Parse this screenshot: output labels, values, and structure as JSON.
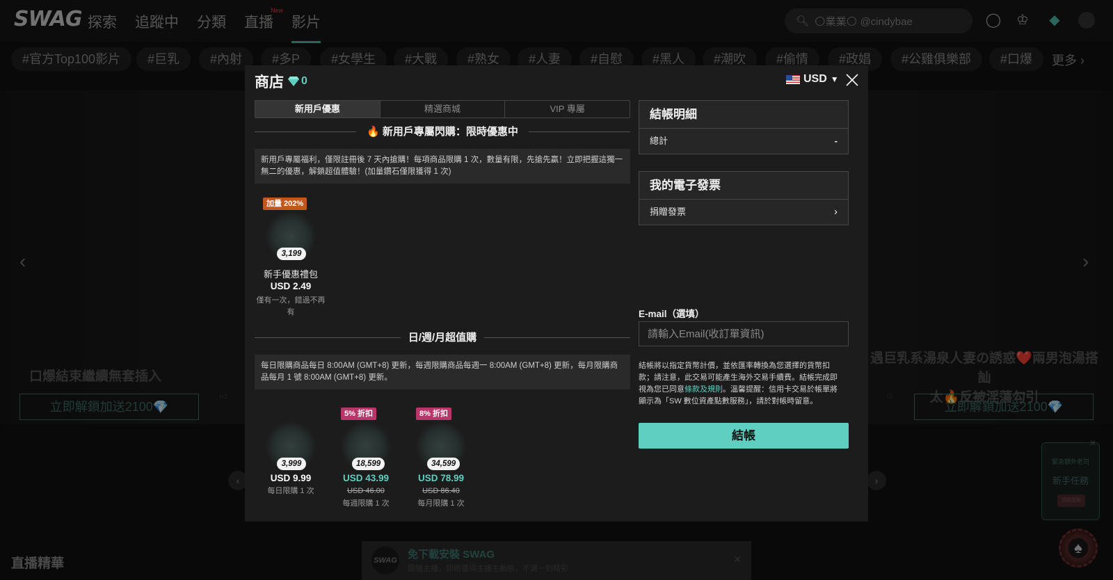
{
  "site": {
    "logo": "SWAG",
    "nav": [
      "探索",
      "追蹤中",
      "分類",
      "直播",
      "影片"
    ],
    "nav_active": 4,
    "new_badge": "New",
    "search_placeholder": "🌕業業🌕 @cindybae",
    "tags": [
      "#官方Top100影片",
      "#巨乳",
      "#內射",
      "#多P",
      "#女學生",
      "#大戰",
      "#熟女",
      "#人妻",
      "#自慰",
      "#黑人",
      "#潮吹",
      "#偷情",
      "#政娼",
      "#公雞俱樂部",
      "#口爆"
    ],
    "more_label": "更多",
    "hero": {
      "left_title": "口爆結束繼續無套插入",
      "right_title_line1": "遇巨乳系湯泉人妻の誘惑❤️兩男泡湯搭訕",
      "right_title_line2": "太🔥反被淫蕩勾引",
      "left_button": "立即解鎖加送2100💎",
      "right_button": "立即解鎖加送2100💎"
    },
    "section_title": "直播精華",
    "download_banner": {
      "logo": "SWAG",
      "title": "免下載安裝 SWAG",
      "subtitle": "跟隨主播，即時獲得主播主動態，不漏一刻精彩"
    },
    "task_widget": {
      "top": "緊急額外老司",
      "main": "新手任務",
      "button": "領取獎勵"
    }
  },
  "modal": {
    "title": "商店",
    "gem_count": "0",
    "currency": "USD",
    "tabs": [
      "新用戶優惠",
      "精選商城",
      "VIP 專屬"
    ],
    "section1": {
      "title": "🔥 新用戶專屬閃購：限時優惠中",
      "notice": "新用戶專屬福利，僅限註冊後 7 天內搶購！每項商品限購 1 次，數量有限，先搶先贏！立即把握這獨一無二的優惠，解鎖超值體驗！(加量鑽石僅限獲得 1 次)",
      "products": [
        {
          "badge": "加量 202%",
          "amount": "3,199",
          "name": "新手優惠禮包",
          "price": "USD 2.49",
          "note": "僅有一次，錯過不再有"
        }
      ]
    },
    "section2": {
      "title": "日/週/月超值購",
      "notice": "每日限購商品每日 8:00AM (GMT+8) 更新，每週限購商品每週一 8:00AM (GMT+8) 更新，每月限購商品每月 1 號 8:00AM (GMT+8) 更新。",
      "products": [
        {
          "badge": "",
          "amount": "3,999",
          "price": "USD 9.99",
          "original": "",
          "note": "每日限購 1 次"
        },
        {
          "badge": "5% 折扣",
          "amount": "18,599",
          "price": "USD 43.99",
          "original": "USD 46.00",
          "note": "每週限購 1 次"
        },
        {
          "badge": "8% 折扣",
          "amount": "34,599",
          "price": "USD 78.99",
          "original": "USD 86.40",
          "note": "每月限購 1 次"
        }
      ]
    },
    "checkout_detail": {
      "title": "結帳明細",
      "total_label": "總計",
      "total_value": "-"
    },
    "invoice": {
      "title": "我的電子發票",
      "row_label": "捐贈發票"
    },
    "email": {
      "label": "E-mail（選填）",
      "placeholder": "請輸入Email(收訂單資訊)"
    },
    "legal": {
      "part1": "結帳將以指定貨幣計價，並依匯率轉換為您選擇的貨幣扣款；請注意，此交易可能產生海外交易手續費。結帳完成即視為您已同意",
      "link": "條款及規則",
      "part2": "。溫馨提醒：信用卡交易於帳單將顯示為「SW 數位資產點數服務」，請於對帳時留意。"
    },
    "checkout_button": "結帳"
  },
  "colors": {
    "accent": "#5ecfc0",
    "badge_orange": "#c2561d",
    "badge_pink": "#b8376a",
    "modal_bg": "#1c1c1c"
  }
}
